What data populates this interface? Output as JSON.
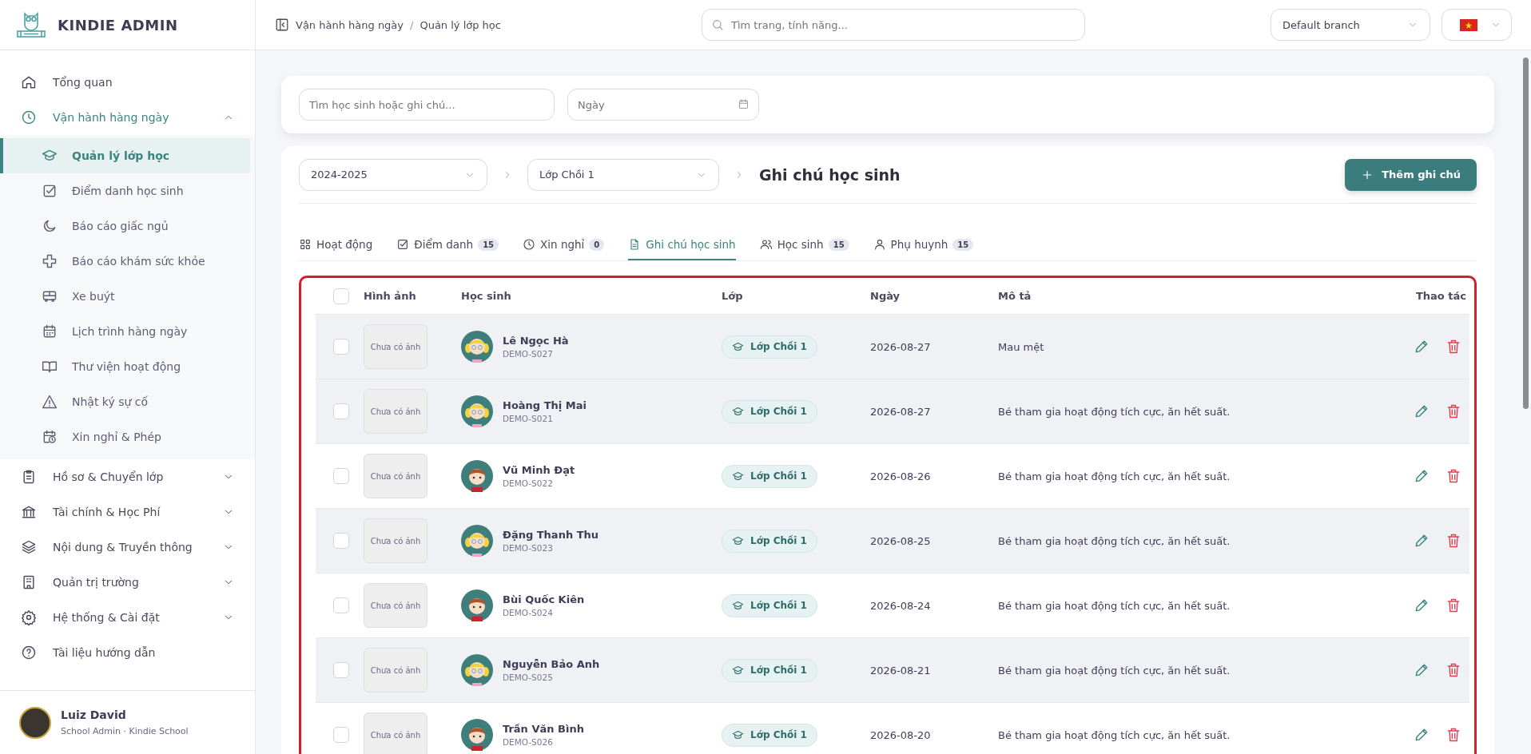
{
  "brand": {
    "name": "KINDIE ADMIN"
  },
  "breadcrumb": {
    "items": [
      "Vận hành hàng ngày",
      "Quản lý lớp học"
    ],
    "separator": "/"
  },
  "global_search": {
    "placeholder": "Tìm trang, tính năng..."
  },
  "branch_select": {
    "value": "Default branch"
  },
  "sidebar": {
    "items": [
      {
        "kind": "home",
        "label": "Tổng quan"
      },
      {
        "kind": "clock",
        "label": "Vận hành hàng ngày",
        "expanded": true,
        "children": [
          {
            "kind": "cap",
            "label": "Quản lý lớp học",
            "selected": true
          },
          {
            "kind": "check",
            "label": "Điểm danh học sinh",
            "selected": false
          },
          {
            "kind": "moon",
            "label": "Báo cáo giấc ngủ",
            "selected": false
          },
          {
            "kind": "plus",
            "label": "Báo cáo khám sức khỏe",
            "selected": false
          },
          {
            "kind": "bus",
            "label": "Xe buýt",
            "selected": false
          },
          {
            "kind": "calendar",
            "label": "Lịch trình hàng ngày",
            "selected": false
          },
          {
            "kind": "book",
            "label": "Thư viện hoạt động",
            "selected": false
          },
          {
            "kind": "warning",
            "label": "Nhật ký sự cố",
            "selected": false
          },
          {
            "kind": "calclock",
            "label": "Xin nghỉ & Phép",
            "selected": false
          }
        ]
      },
      {
        "kind": "clipboard",
        "label": "Hồ sơ & Chuyển lớp",
        "expanded": false
      },
      {
        "kind": "bank",
        "label": "Tài chính & Học Phí",
        "expanded": false
      },
      {
        "kind": "layers",
        "label": "Nội dung & Truyền thông",
        "expanded": false
      },
      {
        "kind": "building",
        "label": "Quản trị trường",
        "expanded": false
      },
      {
        "kind": "gear",
        "label": "Hệ thống & Cài đặt",
        "expanded": false
      },
      {
        "kind": "help",
        "label": "Tài liệu hướng dẫn"
      }
    ]
  },
  "user": {
    "name": "Luiz David",
    "role": "School Admin · Kindie School"
  },
  "filters": {
    "search_placeholder": "Tìm học sinh hoặc ghi chú...",
    "date_placeholder": "Ngày"
  },
  "selectors": {
    "year": "2024-2025",
    "class": "Lớp Chồi 1",
    "title": "Ghi chú học sinh",
    "add_button": "Thêm ghi chú"
  },
  "tabs": [
    {
      "kind": "grid",
      "label": "Hoạt động",
      "selected": false
    },
    {
      "kind": "check",
      "label": "Điểm danh",
      "count": "15",
      "selected": false
    },
    {
      "kind": "clock",
      "label": "Xin nghỉ",
      "count": "0",
      "selected": false
    },
    {
      "kind": "doc",
      "label": "Ghi chú học sinh",
      "selected": true
    },
    {
      "kind": "users",
      "label": "Học sinh",
      "count": "15",
      "selected": false
    },
    {
      "kind": "user",
      "label": "Phụ huynh",
      "count": "15",
      "selected": false
    }
  ],
  "table": {
    "columns": [
      "Hình ảnh",
      "Học sinh",
      "Lớp",
      "Ngày",
      "Mô tả",
      "Thao tác"
    ],
    "select_all": {
      "checked": false
    },
    "rows": [
      {
        "checked": false,
        "shaded": true,
        "photo": "Chưa có ảnh",
        "kind": "girl",
        "name": "Lê Ngọc Hà",
        "code": "DEMO-S027",
        "class": "Lớp Chồi 1",
        "date": "2026-08-27",
        "description": "Mau mệt"
      },
      {
        "checked": false,
        "shaded": true,
        "photo": "Chưa có ảnh",
        "kind": "girl",
        "name": "Hoàng Thị Mai",
        "code": "DEMO-S021",
        "class": "Lớp Chồi 1",
        "date": "2026-08-27",
        "description": "Bé tham gia hoạt động tích cực, ăn hết suất."
      },
      {
        "checked": false,
        "shaded": false,
        "photo": "Chưa có ảnh",
        "kind": "boy",
        "name": "Vũ Minh Đạt",
        "code": "DEMO-S022",
        "class": "Lớp Chồi 1",
        "date": "2026-08-26",
        "description": "Bé tham gia hoạt động tích cực, ăn hết suất."
      },
      {
        "checked": false,
        "shaded": true,
        "photo": "Chưa có ảnh",
        "kind": "girl",
        "name": "Đặng Thanh Thu",
        "code": "DEMO-S023",
        "class": "Lớp Chồi 1",
        "date": "2026-08-25",
        "description": "Bé tham gia hoạt động tích cực, ăn hết suất."
      },
      {
        "checked": false,
        "shaded": false,
        "photo": "Chưa có ảnh",
        "kind": "boy",
        "name": "Bùi Quốc Kiên",
        "code": "DEMO-S024",
        "class": "Lớp Chồi 1",
        "date": "2026-08-24",
        "description": "Bé tham gia hoạt động tích cực, ăn hết suất."
      },
      {
        "checked": false,
        "shaded": true,
        "photo": "Chưa có ảnh",
        "kind": "girl",
        "name": "Nguyễn Bảo Anh",
        "code": "DEMO-S025",
        "class": "Lớp Chồi 1",
        "date": "2026-08-21",
        "description": "Bé tham gia hoạt động tích cực, ăn hết suất."
      },
      {
        "checked": false,
        "shaded": false,
        "photo": "Chưa có ảnh",
        "kind": "boy",
        "name": "Trần Văn Bình",
        "code": "DEMO-S026",
        "class": "Lớp Chồi 1",
        "date": "2026-08-20",
        "description": "Bé tham gia hoạt động tích cực, ăn hết suất."
      }
    ]
  }
}
